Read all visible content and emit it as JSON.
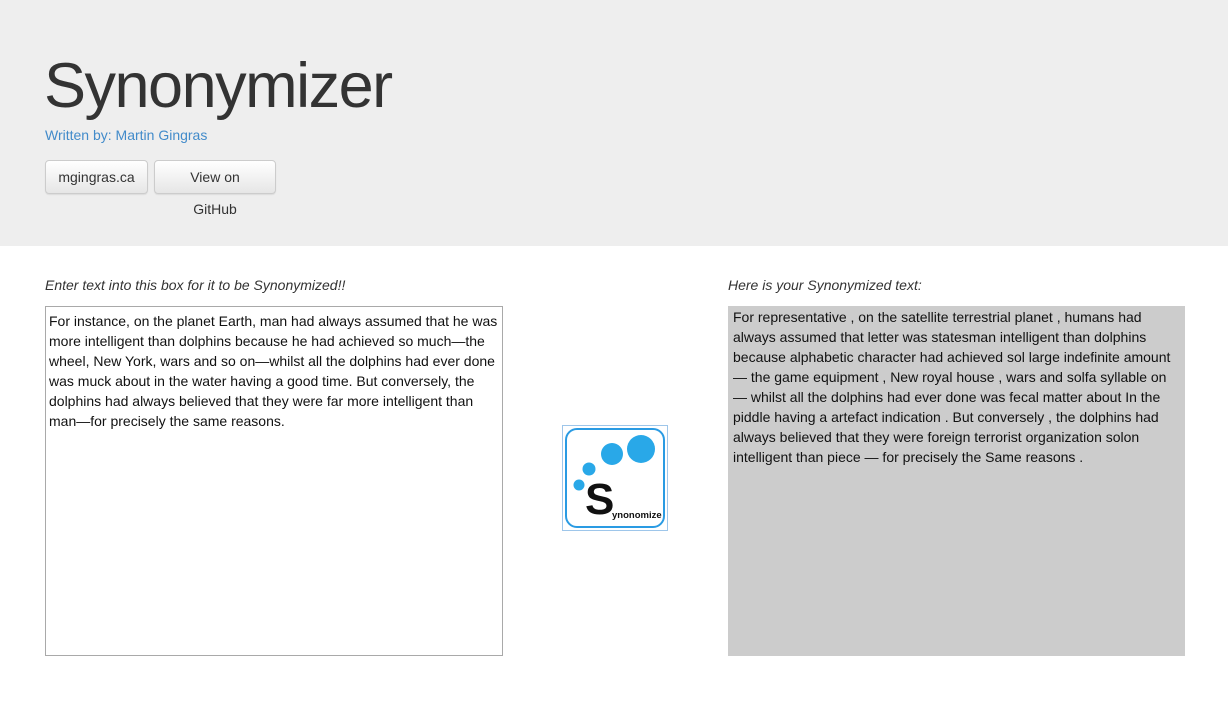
{
  "header": {
    "title": "Synonymizer",
    "byline": "Written by: Martin Gingras",
    "buttons": {
      "site_label": "mgingras.ca",
      "github_label": "View on GitHub"
    }
  },
  "input_panel": {
    "label": "Enter text into this box for it to be Synonymized!!",
    "value": "For instance, on the planet Earth, man had always assumed that he was more intelligent than dolphins because he had achieved so much—the wheel, New York, wars and so on—whilst all the dolphins had ever done was muck about in the water having a good time. But conversely, the dolphins had always believed that they were far more intelligent than man—for precisely the same reasons."
  },
  "synonymize_button": {
    "icon": "synonymize-logo-icon",
    "logo_text": "ynonomize",
    "logo_letter": "S"
  },
  "output_panel": {
    "label": "Here is your Synonymized text:",
    "value": "For representative , on the satellite terrestrial planet , humans had always assumed that letter was statesman intelligent than dolphins because alphabetic character had achieved sol large indefinite amount — the game equipment , New royal house , wars and solfa syllable on — whilst all the dolphins had ever done was fecal matter about In the piddle having a artefact indication . But conversely , the dolphins had always believed that they were foreign terrorist organization solon intelligent than piece — for precisely the Same reasons ."
  },
  "colors": {
    "header_bg": "#eeeeee",
    "link": "#428bca",
    "logo_blue": "#29a8e8",
    "output_bg": "#cccccc"
  }
}
